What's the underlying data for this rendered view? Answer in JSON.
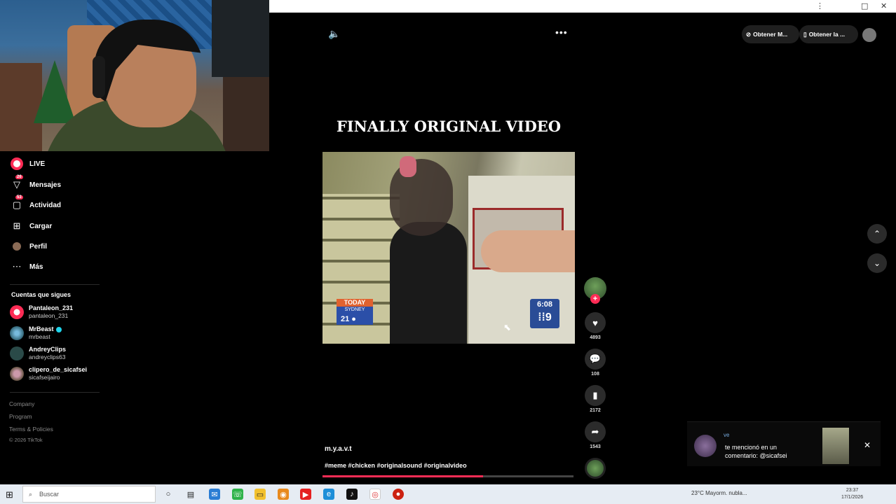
{
  "window": {
    "controls": [
      "⋮",
      "□",
      "✕"
    ]
  },
  "sidebar": {
    "items": [
      {
        "label": "LIVE",
        "icon": "live-icon",
        "badge": ""
      },
      {
        "label": "Mensajes",
        "icon": "message-icon",
        "badge": "26"
      },
      {
        "label": "Actividad",
        "icon": "activity-icon",
        "badge": "53"
      },
      {
        "label": "Cargar",
        "icon": "upload-icon",
        "badge": ""
      },
      {
        "label": "Perfil",
        "icon": "profile-icon",
        "badge": ""
      },
      {
        "label": "Más",
        "icon": "more-icon",
        "badge": ""
      }
    ],
    "following_title": "Cuentas que sigues",
    "following": [
      {
        "name": "Pantaleon_231",
        "handle": "pantaleon_231",
        "verified": false
      },
      {
        "name": "MrBeast",
        "handle": "mrbeast",
        "verified": true
      },
      {
        "name": "AndreyClips",
        "handle": "andreyclips63",
        "verified": false
      },
      {
        "name": "clipero_de_sicafsei",
        "handle": "sicafseijairo",
        "verified": false
      }
    ],
    "footer": [
      "Company",
      "Program",
      "Terms & Policies",
      "© 2026 TikTok"
    ]
  },
  "video": {
    "title": "FINALLY ORIGINAL VIDEO",
    "overlay_today": "TODAY",
    "overlay_city": "SYDNEY",
    "overlay_temp": "21",
    "overlay_time": "6:08",
    "overlay_channel": "9",
    "author": "m.y.a.v.t",
    "hashtags": "#meme #chicken #originalsound #originalvideo",
    "progress": 0.64
  },
  "actions": {
    "likes": "4893",
    "comments": "108",
    "saves": "2172",
    "shares": "1543"
  },
  "topbar": {
    "btn1": "Obtener M...",
    "btn2": "Obtener la ..."
  },
  "notification": {
    "line1": "ve",
    "line2": "te mencionó en un comentario: @sicafsei"
  },
  "taskbar": {
    "search_placeholder": "Buscar",
    "weather": "23°C  Mayorm. nubla...",
    "time": "23:37",
    "date": "17/1/2026"
  },
  "colors": {
    "accent": "#fe2c55",
    "background": "#000000"
  }
}
